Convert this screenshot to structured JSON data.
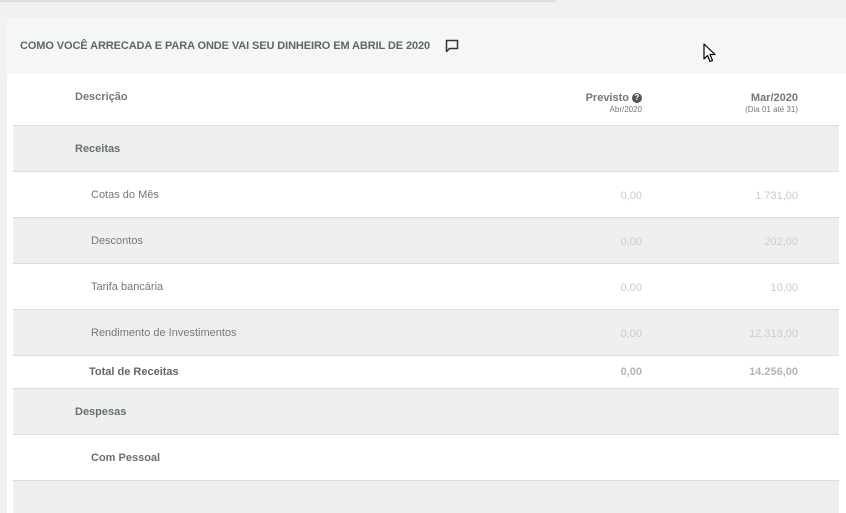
{
  "section_title": "COMO VOCÊ ARRECADA E PARA ONDE VAI SEU DINHEIRO EM ABRIL DE 2020",
  "columns": {
    "description": "Descrição",
    "previsto": "Previsto",
    "previsto_sub": "Abr/2020",
    "month": "Mar/2020",
    "month_sub": "(Dia 01 até 31)",
    "help_glyph": "?"
  },
  "receitas": {
    "label": "Receitas",
    "items": [
      {
        "label": "Cotas do Mês",
        "previsto": "0,00",
        "value": "1.731,00"
      },
      {
        "label": "Descontos",
        "previsto": "0,00",
        "value": "202,00"
      },
      {
        "label": "Tarifa bancária",
        "previsto": "0,00",
        "value": "10,00"
      },
      {
        "label": "Rendimento de Investimentos",
        "previsto": "0,00",
        "value": "12.313,00"
      }
    ],
    "total": {
      "label": "Total de Receitas",
      "previsto": "0,00",
      "value": "14.256,00"
    }
  },
  "despesas": {
    "label": "Despesas",
    "subsection": "Com Pessoal"
  },
  "icons": {
    "comment": "comment-icon",
    "help": "help-circle-icon",
    "cursor": "mouse-pointer-icon"
  }
}
